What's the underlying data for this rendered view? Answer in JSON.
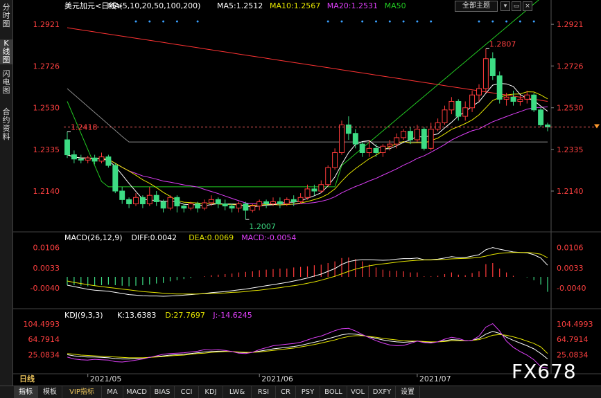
{
  "sidebar": {
    "tabs": [
      "分时图",
      "K线图",
      "闪电图",
      "合约资料"
    ],
    "active": 1
  },
  "top_controls": {
    "theme_label": "全部主题",
    "buttons": [
      "▾",
      "▭",
      "×"
    ]
  },
  "period_label": "日线",
  "watermark": "FX678",
  "bottom_tabs": [
    "指标",
    "模板",
    "VIP指标",
    "MA",
    "MACD",
    "BIAS",
    "CCI",
    "KDJ",
    "LW&",
    "RSI",
    "CR",
    "PSY",
    "BOLL",
    "VOL",
    "DXFY",
    "设置"
  ],
  "bottom_active": 0,
  "colors": {
    "up": "#ff3b3b",
    "down": "#3ddc84",
    "ma5": "#ffffff",
    "ma10": "#e6e600",
    "ma20": "#e040fb",
    "ma50": "#22cc22",
    "ma100": "#888888",
    "ma200": "#ff3333"
  },
  "chart_data": [
    {
      "type": "candlestick",
      "title_parts": [
        {
          "text": "美元加元<日线>",
          "color": "#ffffff"
        },
        {
          "text": "MA(5,10,20,50,100,200)",
          "color": "#ffffff"
        },
        {
          "text": "MA5:1.2512",
          "color": "#ffffff"
        },
        {
          "text": "MA10:1.2567",
          "color": "#e6e600"
        },
        {
          "text": "MA20:1.2531",
          "color": "#e040fb"
        },
        {
          "text": "MA50",
          "color": "#22cc22"
        }
      ],
      "y_ticks": [
        1.2921,
        1.2726,
        1.253,
        1.2335,
        1.214
      ],
      "ylim": [
        1.1965,
        1.297
      ],
      "x_labels": [
        {
          "index": 3,
          "label": "2021/05"
        },
        {
          "index": 28,
          "label": "2021/06"
        },
        {
          "index": 51,
          "label": "2021/07"
        }
      ],
      "current_price": 1.244,
      "annotations": [
        {
          "label": "1.2418",
          "index": 0,
          "value": 1.2418
        },
        {
          "label": "1.2807",
          "index": 61,
          "value": 1.2807
        },
        {
          "label": "1.2007",
          "index": 26,
          "value": 1.2007
        }
      ],
      "candles": [
        [
          1.238,
          1.231,
          1.2418,
          1.2295
        ],
        [
          1.231,
          1.229,
          1.233,
          1.227
        ],
        [
          1.229,
          1.2285,
          1.231,
          1.227
        ],
        [
          1.2285,
          1.2295,
          1.2305,
          1.227
        ],
        [
          1.2295,
          1.228,
          1.231,
          1.2265
        ],
        [
          1.228,
          1.23,
          1.232,
          1.227
        ],
        [
          1.23,
          1.226,
          1.231,
          1.225
        ],
        [
          1.226,
          1.214,
          1.227,
          1.213
        ],
        [
          1.214,
          1.21,
          1.216,
          1.208
        ],
        [
          1.21,
          1.208,
          1.211,
          1.206
        ],
        [
          1.208,
          1.211,
          1.213,
          1.207
        ],
        [
          1.211,
          1.208,
          1.212,
          1.206
        ],
        [
          1.208,
          1.212,
          1.216,
          1.207
        ],
        [
          1.212,
          1.209,
          1.214,
          1.207
        ],
        [
          1.209,
          1.206,
          1.21,
          1.204
        ],
        [
          1.206,
          1.211,
          1.212,
          1.205
        ],
        [
          1.211,
          1.207,
          1.212,
          1.204
        ],
        [
          1.207,
          1.206,
          1.208,
          1.204
        ],
        [
          1.206,
          1.208,
          1.209,
          1.205
        ],
        [
          1.208,
          1.206,
          1.209,
          1.204
        ],
        [
          1.206,
          1.2085,
          1.21,
          1.205
        ],
        [
          1.2085,
          1.21,
          1.212,
          1.207
        ],
        [
          1.21,
          1.208,
          1.211,
          1.206
        ],
        [
          1.208,
          1.207,
          1.21,
          1.205
        ],
        [
          1.207,
          1.206,
          1.208,
          1.204
        ],
        [
          1.206,
          1.208,
          1.209,
          1.204
        ],
        [
          1.208,
          1.205,
          1.209,
          1.2007
        ],
        [
          1.205,
          1.207,
          1.208,
          1.204
        ],
        [
          1.207,
          1.209,
          1.21,
          1.205
        ],
        [
          1.209,
          1.208,
          1.21,
          1.206
        ],
        [
          1.208,
          1.209,
          1.211,
          1.207
        ],
        [
          1.209,
          1.208,
          1.211,
          1.206
        ],
        [
          1.208,
          1.21,
          1.211,
          1.207
        ],
        [
          1.21,
          1.209,
          1.212,
          1.207
        ],
        [
          1.209,
          1.211,
          1.213,
          1.208
        ],
        [
          1.211,
          1.215,
          1.217,
          1.21
        ],
        [
          1.215,
          1.214,
          1.217,
          1.212
        ],
        [
          1.214,
          1.217,
          1.219,
          1.213
        ],
        [
          1.217,
          1.225,
          1.226,
          1.216
        ],
        [
          1.225,
          1.232,
          1.234,
          1.224
        ],
        [
          1.232,
          1.245,
          1.247,
          1.231
        ],
        [
          1.245,
          1.241,
          1.249,
          1.238
        ],
        [
          1.241,
          1.236,
          1.243,
          1.234
        ],
        [
          1.236,
          1.232,
          1.237,
          1.23
        ],
        [
          1.232,
          1.234,
          1.238,
          1.23
        ],
        [
          1.234,
          1.232,
          1.236,
          1.23
        ],
        [
          1.232,
          1.235,
          1.236,
          1.23
        ],
        [
          1.235,
          1.236,
          1.238,
          1.233
        ],
        [
          1.236,
          1.239,
          1.241,
          1.234
        ],
        [
          1.239,
          1.242,
          1.243,
          1.238
        ],
        [
          1.242,
          1.238,
          1.244,
          1.236
        ],
        [
          1.238,
          1.243,
          1.245,
          1.237
        ],
        [
          1.243,
          1.234,
          1.244,
          1.233
        ],
        [
          1.234,
          1.243,
          1.246,
          1.233
        ],
        [
          1.243,
          1.246,
          1.248,
          1.242
        ],
        [
          1.246,
          1.252,
          1.254,
          1.245
        ],
        [
          1.252,
          1.256,
          1.258,
          1.25
        ],
        [
          1.256,
          1.249,
          1.257,
          1.247
        ],
        [
          1.249,
          1.253,
          1.256,
          1.247
        ],
        [
          1.253,
          1.259,
          1.261,
          1.251
        ],
        [
          1.259,
          1.262,
          1.264,
          1.256
        ],
        [
          1.262,
          1.276,
          1.2807,
          1.26
        ],
        [
          1.276,
          1.268,
          1.279,
          1.266
        ],
        [
          1.268,
          1.257,
          1.27,
          1.255
        ],
        [
          1.257,
          1.258,
          1.26,
          1.254
        ],
        [
          1.258,
          1.256,
          1.261,
          1.254
        ],
        [
          1.256,
          1.257,
          1.259,
          1.254
        ],
        [
          1.257,
          1.259,
          1.261,
          1.255
        ],
        [
          1.259,
          1.252,
          1.26,
          1.251
        ],
        [
          1.252,
          1.245,
          1.253,
          1.244
        ],
        [
          1.245,
          1.244,
          1.246,
          1.242
        ]
      ],
      "markers_top": [
        10,
        12,
        14,
        16,
        19,
        38,
        40,
        43,
        45,
        47,
        49,
        51,
        53,
        60,
        62,
        64,
        66,
        68
      ]
    },
    {
      "type": "line",
      "title_parts": [
        {
          "text": "MACD(26,12,9)",
          "color": "#ffffff"
        },
        {
          "text": "DIFF:0.0042",
          "color": "#ffffff"
        },
        {
          "text": "DEA:0.0069",
          "color": "#e6e600"
        },
        {
          "text": "MACD:-0.0054",
          "color": "#e040fb"
        }
      ],
      "y_ticks": [
        0.0106,
        0.0033,
        -0.004
      ],
      "ylim": [
        -0.007,
        0.012
      ],
      "series": [
        {
          "name": "DIFF",
          "color": "#ffffff",
          "values": [
            -0.003,
            -0.0035,
            -0.004,
            -0.0045,
            -0.0048,
            -0.005,
            -0.0052,
            -0.0056,
            -0.006,
            -0.0064,
            -0.0066,
            -0.0068,
            -0.0069,
            -0.0069,
            -0.007,
            -0.0069,
            -0.0068,
            -0.0066,
            -0.0064,
            -0.0062,
            -0.006,
            -0.0057,
            -0.0055,
            -0.0053,
            -0.005,
            -0.0047,
            -0.0044,
            -0.004,
            -0.0036,
            -0.0032,
            -0.0028,
            -0.0024,
            -0.002,
            -0.0015,
            -0.001,
            -0.0004,
            0.0003,
            0.001,
            0.002,
            0.003,
            0.0045,
            0.0055,
            0.006,
            0.0062,
            0.0062,
            0.0061,
            0.006,
            0.0061,
            0.0064,
            0.0066,
            0.0066,
            0.0068,
            0.0062,
            0.0062,
            0.0064,
            0.0068,
            0.0073,
            0.007,
            0.007,
            0.0075,
            0.008,
            0.0098,
            0.0106,
            0.01,
            0.0095,
            0.009,
            0.0088,
            0.0087,
            0.008,
            0.0068,
            0.0042
          ]
        },
        {
          "name": "DEA",
          "color": "#e6e600",
          "values": [
            -0.0015,
            -0.002,
            -0.0024,
            -0.0028,
            -0.0032,
            -0.0035,
            -0.0038,
            -0.0041,
            -0.0044,
            -0.0047,
            -0.005,
            -0.0053,
            -0.0055,
            -0.0057,
            -0.0059,
            -0.0061,
            -0.0062,
            -0.0062,
            -0.0062,
            -0.0062,
            -0.0061,
            -0.006,
            -0.0059,
            -0.0058,
            -0.0056,
            -0.0055,
            -0.0053,
            -0.005,
            -0.0048,
            -0.0045,
            -0.0042,
            -0.0039,
            -0.0035,
            -0.0032,
            -0.0028,
            -0.0023,
            -0.0018,
            -0.0012,
            -0.0005,
            0.0002,
            0.0011,
            0.002,
            0.0028,
            0.0034,
            0.004,
            0.0044,
            0.0047,
            0.005,
            0.0053,
            0.0056,
            0.0058,
            0.006,
            0.0061,
            0.0061,
            0.0062,
            0.0063,
            0.0065,
            0.0066,
            0.0067,
            0.0068,
            0.007,
            0.0075,
            0.0081,
            0.0085,
            0.0087,
            0.0088,
            0.0088,
            0.0088,
            0.0086,
            0.0082,
            0.0069
          ]
        },
        {
          "name": "MACD",
          "color": "#e040fb",
          "bars": true,
          "values": [
            -0.003,
            -0.003,
            -0.0032,
            -0.0034,
            -0.0032,
            -0.003,
            -0.0028,
            -0.003,
            -0.0032,
            -0.0034,
            -0.0032,
            -0.003,
            -0.0028,
            -0.0024,
            -0.0022,
            -0.0016,
            -0.0012,
            -0.0008,
            -0.0004,
            0.0,
            0.0002,
            0.0006,
            0.0008,
            0.001,
            0.0012,
            0.0016,
            0.0018,
            0.002,
            0.0024,
            0.0026,
            0.0028,
            0.003,
            0.003,
            0.0034,
            0.0036,
            0.0038,
            0.0042,
            0.0044,
            0.005,
            0.0056,
            0.0068,
            0.007,
            0.0064,
            0.0056,
            0.0044,
            0.0034,
            0.0026,
            0.0022,
            0.0022,
            0.002,
            0.0016,
            0.0016,
            0.0002,
            0.0002,
            0.0004,
            0.001,
            0.0016,
            0.0008,
            0.0006,
            0.0014,
            0.002,
            0.0046,
            0.005,
            0.003,
            0.0016,
            0.0004,
            0.0,
            -0.0002,
            -0.0012,
            -0.0028,
            -0.0054
          ]
        }
      ]
    },
    {
      "type": "line",
      "title_parts": [
        {
          "text": "KDJ(9,3,3)",
          "color": "#ffffff"
        },
        {
          "text": "K:13.6383",
          "color": "#ffffff"
        },
        {
          "text": "D:27.7697",
          "color": "#e6e600"
        },
        {
          "text": "J:-14.6245",
          "color": "#e040fb"
        }
      ],
      "y_ticks": [
        104.4993,
        64.7914,
        25.0834
      ],
      "ylim": [
        -10,
        115
      ],
      "series": [
        {
          "name": "K",
          "color": "#ffffff",
          "values": [
            25,
            22,
            20,
            19,
            19,
            18,
            17,
            15,
            14,
            14,
            15,
            16,
            18,
            20,
            22,
            24,
            25,
            26,
            28,
            30,
            32,
            33,
            34,
            34,
            33,
            31,
            30,
            31,
            34,
            37,
            40,
            42,
            44,
            46,
            49,
            53,
            57,
            61,
            66,
            71,
            76,
            79,
            78,
            75,
            71,
            67,
            63,
            60,
            58,
            57,
            58,
            60,
            58,
            57,
            58,
            61,
            64,
            63,
            61,
            62,
            67,
            78,
            85,
            80,
            70,
            62,
            55,
            48,
            40,
            28,
            14
          ]
        },
        {
          "name": "D",
          "color": "#e6e600",
          "values": [
            28,
            26,
            24,
            23,
            22,
            21,
            20,
            19,
            18,
            17,
            17,
            17,
            18,
            19,
            20,
            22,
            23,
            24,
            26,
            28,
            29,
            31,
            32,
            33,
            33,
            32,
            31,
            31,
            32,
            34,
            36,
            38,
            40,
            42,
            45,
            48,
            51,
            55,
            59,
            63,
            68,
            72,
            74,
            74,
            72,
            70,
            67,
            65,
            63,
            61,
            60,
            60,
            59,
            58,
            58,
            59,
            61,
            61,
            61,
            62,
            64,
            69,
            75,
            77,
            75,
            71,
            66,
            60,
            54,
            45,
            28
          ]
        },
        {
          "name": "J",
          "color": "#e040fb",
          "values": [
            19,
            14,
            12,
            11,
            13,
            12,
            11,
            7,
            6,
            8,
            11,
            14,
            18,
            22,
            26,
            28,
            29,
            30,
            32,
            34,
            38,
            37,
            38,
            36,
            33,
            29,
            28,
            31,
            38,
            43,
            48,
            50,
            52,
            54,
            57,
            63,
            69,
            73,
            80,
            87,
            92,
            93,
            86,
            77,
            69,
            61,
            55,
            50,
            48,
            49,
            54,
            60,
            56,
            55,
            58,
            65,
            70,
            67,
            61,
            62,
            73,
            96,
            105,
            86,
            60,
            44,
            33,
            24,
            12,
            -6,
            -14
          ]
        }
      ]
    }
  ]
}
